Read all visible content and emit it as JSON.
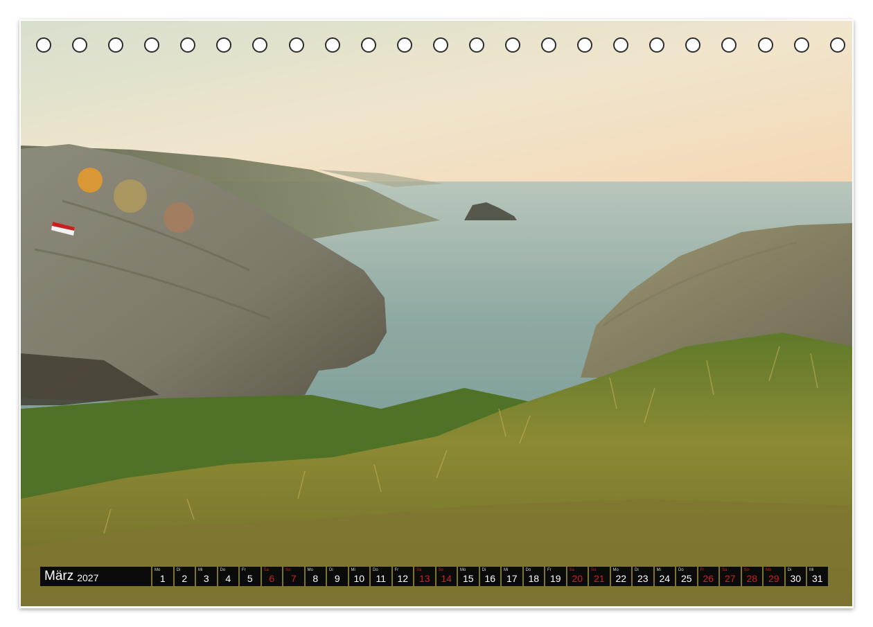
{
  "calendar": {
    "month": "März",
    "year": "2027",
    "days": [
      {
        "wd": "Mo",
        "d": "1",
        "weekend": false
      },
      {
        "wd": "Di",
        "d": "2",
        "weekend": false
      },
      {
        "wd": "Mi",
        "d": "3",
        "weekend": false
      },
      {
        "wd": "Do",
        "d": "4",
        "weekend": false
      },
      {
        "wd": "Fr",
        "d": "5",
        "weekend": false
      },
      {
        "wd": "Sa",
        "d": "6",
        "weekend": true
      },
      {
        "wd": "So",
        "d": "7",
        "weekend": true
      },
      {
        "wd": "Mo",
        "d": "8",
        "weekend": false
      },
      {
        "wd": "Di",
        "d": "9",
        "weekend": false
      },
      {
        "wd": "Mi",
        "d": "10",
        "weekend": false
      },
      {
        "wd": "Do",
        "d": "11",
        "weekend": false
      },
      {
        "wd": "Fr",
        "d": "12",
        "weekend": false
      },
      {
        "wd": "Sa",
        "d": "13",
        "weekend": true
      },
      {
        "wd": "So",
        "d": "14",
        "weekend": true
      },
      {
        "wd": "Mo",
        "d": "15",
        "weekend": false
      },
      {
        "wd": "Di",
        "d": "16",
        "weekend": false
      },
      {
        "wd": "Mi",
        "d": "17",
        "weekend": false
      },
      {
        "wd": "Do",
        "d": "18",
        "weekend": false
      },
      {
        "wd": "Fr",
        "d": "19",
        "weekend": false
      },
      {
        "wd": "Sa",
        "d": "20",
        "weekend": true
      },
      {
        "wd": "So",
        "d": "21",
        "weekend": true
      },
      {
        "wd": "Mo",
        "d": "22",
        "weekend": false
      },
      {
        "wd": "Di",
        "d": "23",
        "weekend": false
      },
      {
        "wd": "Mi",
        "d": "24",
        "weekend": false
      },
      {
        "wd": "Do",
        "d": "25",
        "weekend": false
      },
      {
        "wd": "Fr",
        "d": "26",
        "weekend": true
      },
      {
        "wd": "Sa",
        "d": "27",
        "weekend": true
      },
      {
        "wd": "So",
        "d": "28",
        "weekend": true
      },
      {
        "wd": "Mo",
        "d": "29",
        "weekend": true
      },
      {
        "wd": "Di",
        "d": "30",
        "weekend": false
      },
      {
        "wd": "Mi",
        "d": "31",
        "weekend": false
      }
    ]
  },
  "binding_holes": 23,
  "colors": {
    "sky_top": "#d9e0cf",
    "sky_bottom": "#f4dcbb",
    "sea": "#8fa8a0",
    "rock": "#8a8576",
    "grass": "#9a8a32",
    "calendar_bar": "#0b0b0b",
    "weekend_red": "#d61f1f"
  }
}
